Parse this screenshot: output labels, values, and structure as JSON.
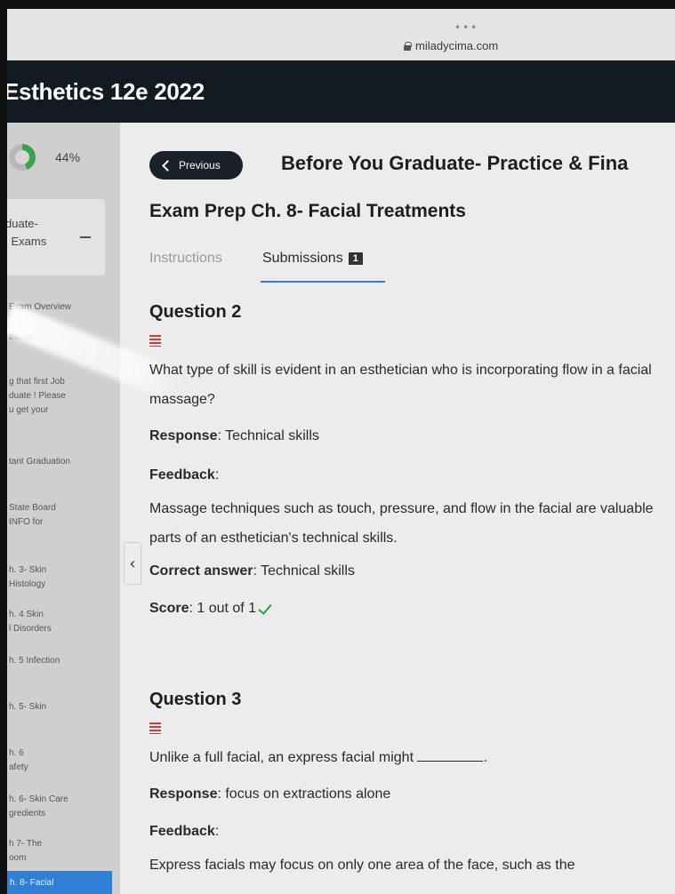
{
  "browser": {
    "dots": "•••",
    "url": "miladycima.com"
  },
  "course": {
    "title": "Esthetics 12e 2022"
  },
  "sidebar": {
    "progress": {
      "percent_value": 44,
      "percent_text": "44%"
    },
    "module": {
      "line1": "duate-",
      "line2": "l Exams"
    },
    "items": [
      {
        "label": "Exam Overview"
      },
      {
        "label": "the Jo"
      },
      {
        "label": "g that first Job"
      },
      {
        "label": "duate ! Please"
      },
      {
        "label": "u get your"
      },
      {
        "label": "tant Graduation"
      },
      {
        "label": "State Board"
      },
      {
        "label": "INFO for"
      },
      {
        "label": "h. 3- Skin"
      },
      {
        "label": "Histology"
      },
      {
        "label": "h. 4 Skin"
      },
      {
        "label": "l Disorders"
      },
      {
        "label": "h. 5 Infection"
      },
      {
        "label": "h. 5- Skin"
      },
      {
        "label": "h. 6"
      },
      {
        "label": "afety"
      },
      {
        "label": "h. 6- Skin Care"
      },
      {
        "label": "gredients"
      },
      {
        "label": "h 7- The"
      },
      {
        "label": "oom"
      },
      {
        "label": "h. 8- Facial"
      }
    ]
  },
  "main": {
    "previous_label": "Previous",
    "page_heading": "Before You Graduate- Practice & Fina",
    "exam_title": "Exam Prep Ch. 8- Facial Treatments",
    "tabs": [
      {
        "label": "Instructions"
      },
      {
        "label": "Submissions",
        "badge": "1"
      }
    ],
    "questions": [
      {
        "title": "Question 2",
        "text": "What type of skill is evident in an esthetician who is incorporating flow in a facial massage?",
        "response_label": "Response",
        "response": ": Technical skills",
        "feedback_label": "Feedback",
        "feedback_suffix": ":",
        "feedback": "Massage techniques such as touch, pressure, and flow in the facial are valuable parts of an esthetician's technical skills.",
        "correct_label": "Correct answer",
        "correct": ": Technical skills",
        "score_label": "Score",
        "score": ": 1 out of 1"
      },
      {
        "title": "Question 3",
        "text_before": "Unlike a full facial, an express facial might ",
        "text_after": ".",
        "response_label": "Response",
        "response": ": focus on extractions alone",
        "feedback_label": "Feedback",
        "feedback_suffix": ":",
        "feedback": "Express facials may focus on only one area of the face, such as the"
      }
    ]
  },
  "colors": {
    "accent": "#3a7bd5",
    "header_bg": "#141a22",
    "check": "#2e9e4a",
    "list_icon": "#d43b3b",
    "active_item": "#2f7fd6"
  }
}
